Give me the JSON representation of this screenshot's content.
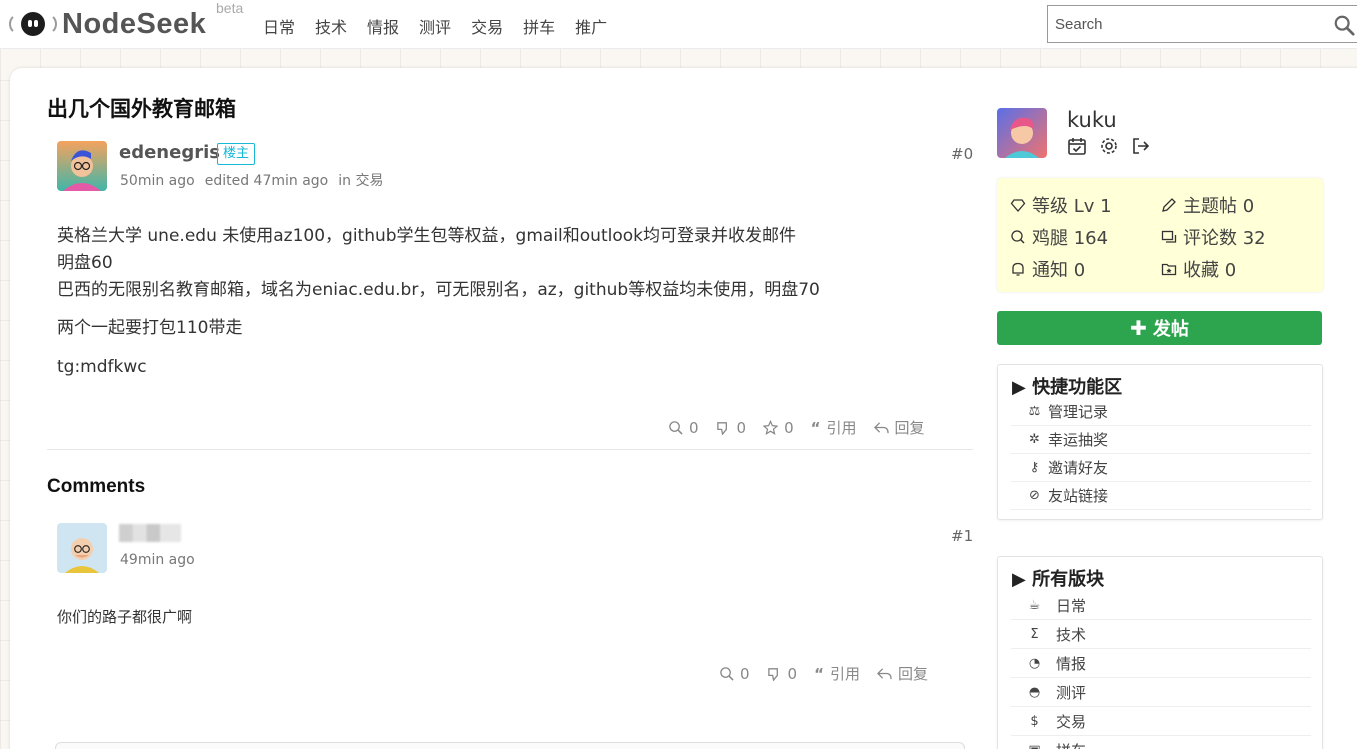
{
  "header": {
    "logo_text": "NodeSeek",
    "beta_label": "beta",
    "nav": [
      "日常",
      "技术",
      "情报",
      "测评",
      "交易",
      "拼车",
      "推广"
    ],
    "search_placeholder": "Search"
  },
  "post": {
    "title": "出几个国外教育邮箱",
    "author": "edenegris",
    "op_badge": "楼主",
    "time": "50min ago",
    "edited": "edited 47min ago",
    "category": "in 交易",
    "floor": "#0",
    "lines": [
      "英格兰大学 une.edu 未使用az100，github学生包等权益，gmail和outlook均可登录并收发邮件",
      "明盘60",
      "巴西的无限别名教育邮箱，域名为eniac.edu.br，可无限别名，az，github等权益均未使用，明盘70",
      "两个一起要打包110带走",
      "tg:mdfkwc"
    ],
    "actions": {
      "chicken": "0",
      "dislike": "0",
      "star": "0",
      "quote": "引用",
      "reply": "回复"
    }
  },
  "comments": {
    "title": "Comments",
    "items": [
      {
        "floor": "#1",
        "time": "49min ago",
        "text": "你们的路子都很广啊",
        "actions": {
          "chicken": "0",
          "dislike": "0",
          "quote": "引用",
          "reply": "回复"
        }
      }
    ]
  },
  "user": {
    "name": "kuku",
    "stats": {
      "level": "等级 Lv 1",
      "topics": "主题帖 0",
      "chicken": "鸡腿 164",
      "comments": "评论数 32",
      "notify": "通知 0",
      "favorites": "收藏 0"
    }
  },
  "post_button": "发帖",
  "quick_panel": {
    "title": "▶ 快捷功能区",
    "items": [
      "管理记录",
      "幸运抽奖",
      "邀请好友",
      "友站链接"
    ]
  },
  "boards_panel": {
    "title": "▶ 所有版块",
    "items": [
      "日常",
      "技术",
      "情报",
      "测评",
      "交易",
      "拼车"
    ]
  },
  "colors": {
    "accent_green": "#2da44e",
    "badge_cyan": "#16b8d6",
    "stats_bg": "#ffffd8"
  }
}
